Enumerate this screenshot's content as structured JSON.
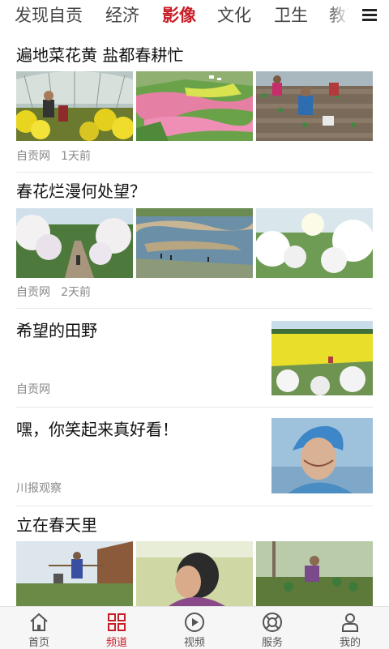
{
  "tabs": [
    {
      "label": "发现自贡"
    },
    {
      "label": "经济"
    },
    {
      "label": "影像",
      "active": true
    },
    {
      "label": "文化"
    },
    {
      "label": "卫生"
    },
    {
      "label": "教育"
    }
  ],
  "articles": [
    {
      "title": "遍地菜花黄 盐都春耕忙",
      "source": "自贡网",
      "time": "1天前"
    },
    {
      "title": "春花烂漫何处望？",
      "source": "自贡网",
      "time": "2天前"
    },
    {
      "title": "希望的田野",
      "source": "自贡网"
    },
    {
      "title": "嘿，你笑起来真好看！",
      "source": "川报观察"
    },
    {
      "title": "立在春天里"
    }
  ],
  "bottom_nav": [
    {
      "label": "首页",
      "icon": "home-icon"
    },
    {
      "label": "频道",
      "icon": "grid-icon",
      "active": true
    },
    {
      "label": "视频",
      "icon": "play-circle-icon"
    },
    {
      "label": "服务",
      "icon": "lifebuoy-icon"
    },
    {
      "label": "我的",
      "icon": "user-icon"
    }
  ],
  "colors": {
    "accent": "#c81e28",
    "text": "#111111",
    "meta": "#888888",
    "divider": "#e6e6e6"
  }
}
